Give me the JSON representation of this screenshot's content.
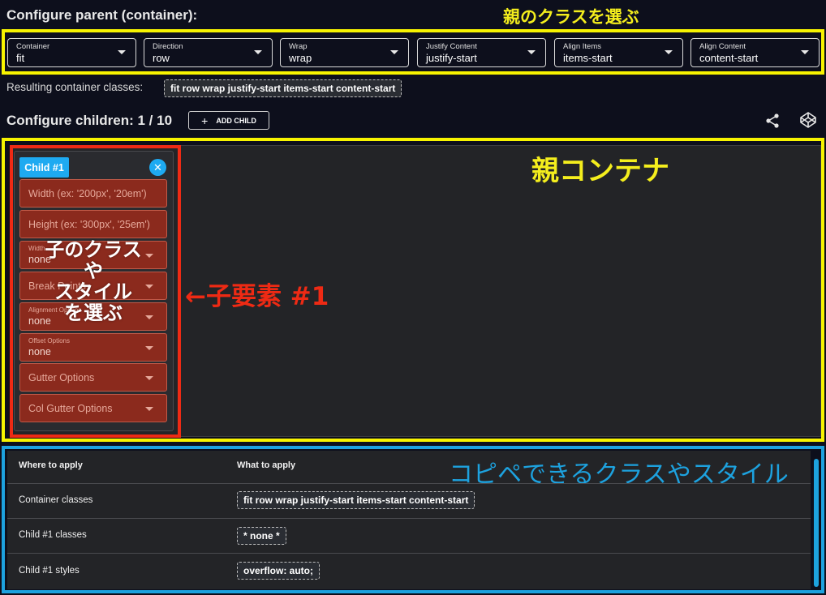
{
  "parent": {
    "title": "Configure parent (container):",
    "annotation": "親のクラスを選ぶ",
    "selects": [
      {
        "label": "Container",
        "value": "fit"
      },
      {
        "label": "Direction",
        "value": "row"
      },
      {
        "label": "Wrap",
        "value": "wrap"
      },
      {
        "label": "Justify Content",
        "value": "justify-start"
      },
      {
        "label": "Align Items",
        "value": "items-start"
      },
      {
        "label": "Align Content",
        "value": "content-start"
      }
    ],
    "result_label": "Resulting container classes:",
    "result_classes": "fit row wrap justify-start items-start content-start"
  },
  "children": {
    "title": "Configure children: 1 / 10",
    "add_label": "ADD CHILD",
    "container_annotation": "親コンテナ",
    "child": {
      "badge": "Child #1",
      "width_placeholder": "Width (ex: '200px', '20em')",
      "height_placeholder": "Height (ex: '300px', '25em')",
      "width_label": "Width",
      "width_value": "none",
      "breakpoints_label": "Break Points",
      "alignment_label": "Alignment Options",
      "alignment_value": "none",
      "offset_label": "Offset Options",
      "offset_value": "none",
      "gutter_label": "Gutter Options",
      "col_gutter_label": "Col Gutter Options"
    },
    "overlay": [
      "子のクラス",
      "や",
      "スタイル",
      "を選ぶ"
    ],
    "child_annotation": "←子要素 #1"
  },
  "table": {
    "annotation": "コピペできるクラスやスタイル",
    "headers": [
      "Where to apply",
      "What to apply"
    ],
    "rows": [
      {
        "where": "Container classes",
        "what": "fit row wrap justify-start items-start content-start"
      },
      {
        "where": "Child #1 classes",
        "what": "* none *"
      },
      {
        "where": "Child #1 styles",
        "what": "overflow: auto;"
      }
    ]
  },
  "icons": {
    "share": "share-icon",
    "codepen": "codepen-icon",
    "plus": "plus-icon",
    "close": "close-icon",
    "dropdown": "chevron-down-icon"
  },
  "colors": {
    "background": "#0d0f1c",
    "panel": "#232427",
    "accent_blue": "#1eaaf1",
    "annot_yellow": "#f7f300",
    "annot_red": "#ee2a14",
    "annot_blue": "#1da2df"
  }
}
